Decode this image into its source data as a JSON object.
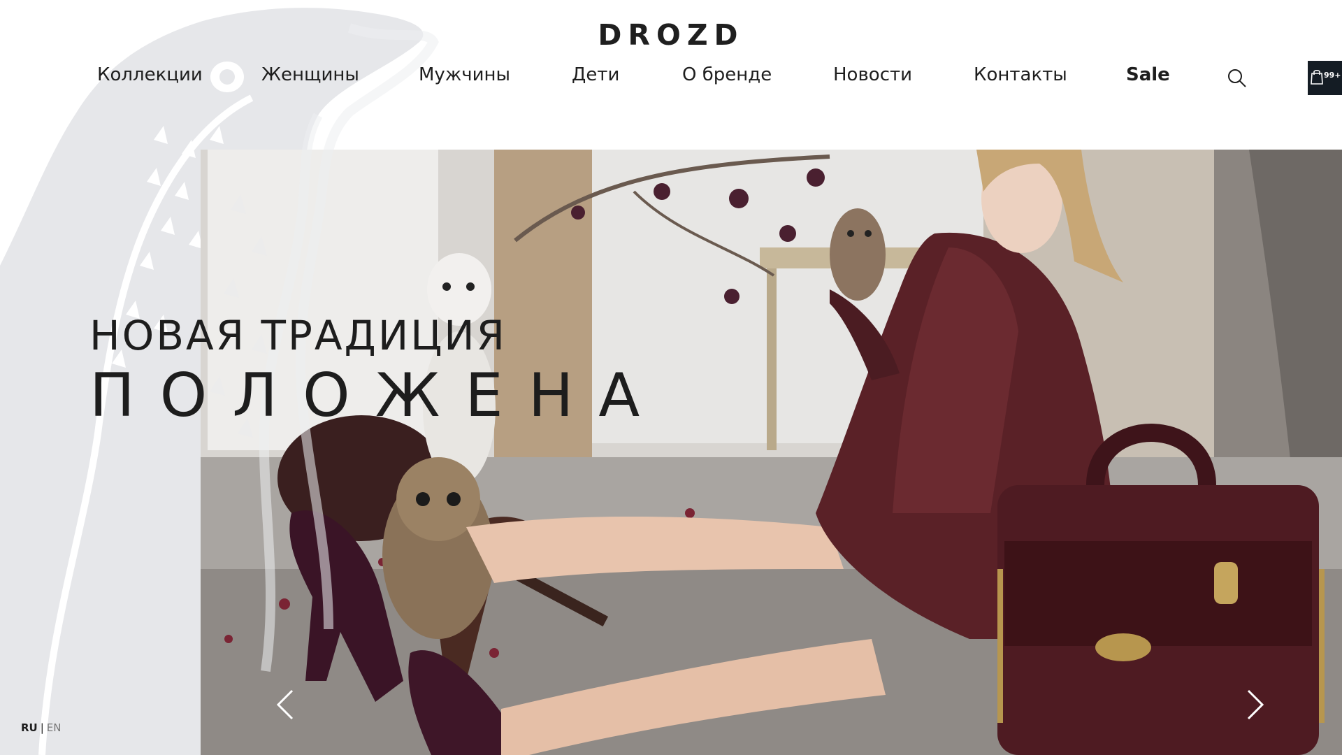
{
  "brand": {
    "logo": "DROZD"
  },
  "nav": {
    "items": [
      {
        "label": "Коллекции"
      },
      {
        "label": "Женщины"
      },
      {
        "label": "Мужчины"
      },
      {
        "label": "Дети"
      },
      {
        "label": "О бренде"
      },
      {
        "label": "Новости"
      },
      {
        "label": "Контакты"
      },
      {
        "label": "Sale"
      }
    ],
    "search_icon": "search-icon",
    "cart": {
      "icon": "shopping-bag-icon",
      "count": "99+"
    }
  },
  "hero": {
    "headline_line1": "НОВАЯ ТРАДИЦИЯ",
    "headline_line2": "ПОЛОЖЕНА",
    "prev_icon": "chevron-left-icon",
    "next_icon": "chevron-right-icon"
  },
  "language": {
    "current": "RU",
    "separator": "|",
    "alternate": "EN"
  },
  "colors": {
    "cart_bg": "#141c24",
    "bird_outline": "#e2e3e6",
    "text": "#1d1d1d"
  }
}
